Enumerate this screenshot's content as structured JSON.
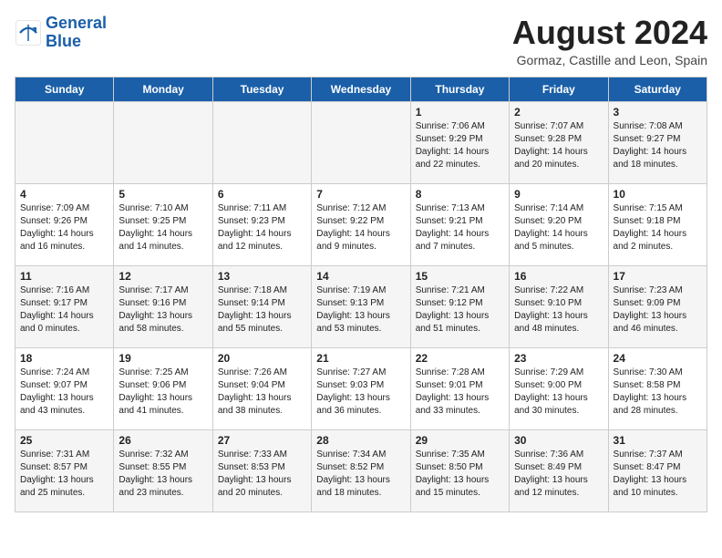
{
  "header": {
    "logo_line1": "General",
    "logo_line2": "Blue",
    "month_year": "August 2024",
    "location": "Gormaz, Castille and Leon, Spain"
  },
  "weekdays": [
    "Sunday",
    "Monday",
    "Tuesday",
    "Wednesday",
    "Thursday",
    "Friday",
    "Saturday"
  ],
  "weeks": [
    [
      {
        "day": "",
        "info": ""
      },
      {
        "day": "",
        "info": ""
      },
      {
        "day": "",
        "info": ""
      },
      {
        "day": "",
        "info": ""
      },
      {
        "day": "1",
        "info": "Sunrise: 7:06 AM\nSunset: 9:29 PM\nDaylight: 14 hours\nand 22 minutes."
      },
      {
        "day": "2",
        "info": "Sunrise: 7:07 AM\nSunset: 9:28 PM\nDaylight: 14 hours\nand 20 minutes."
      },
      {
        "day": "3",
        "info": "Sunrise: 7:08 AM\nSunset: 9:27 PM\nDaylight: 14 hours\nand 18 minutes."
      }
    ],
    [
      {
        "day": "4",
        "info": "Sunrise: 7:09 AM\nSunset: 9:26 PM\nDaylight: 14 hours\nand 16 minutes."
      },
      {
        "day": "5",
        "info": "Sunrise: 7:10 AM\nSunset: 9:25 PM\nDaylight: 14 hours\nand 14 minutes."
      },
      {
        "day": "6",
        "info": "Sunrise: 7:11 AM\nSunset: 9:23 PM\nDaylight: 14 hours\nand 12 minutes."
      },
      {
        "day": "7",
        "info": "Sunrise: 7:12 AM\nSunset: 9:22 PM\nDaylight: 14 hours\nand 9 minutes."
      },
      {
        "day": "8",
        "info": "Sunrise: 7:13 AM\nSunset: 9:21 PM\nDaylight: 14 hours\nand 7 minutes."
      },
      {
        "day": "9",
        "info": "Sunrise: 7:14 AM\nSunset: 9:20 PM\nDaylight: 14 hours\nand 5 minutes."
      },
      {
        "day": "10",
        "info": "Sunrise: 7:15 AM\nSunset: 9:18 PM\nDaylight: 14 hours\nand 2 minutes."
      }
    ],
    [
      {
        "day": "11",
        "info": "Sunrise: 7:16 AM\nSunset: 9:17 PM\nDaylight: 14 hours\nand 0 minutes."
      },
      {
        "day": "12",
        "info": "Sunrise: 7:17 AM\nSunset: 9:16 PM\nDaylight: 13 hours\nand 58 minutes."
      },
      {
        "day": "13",
        "info": "Sunrise: 7:18 AM\nSunset: 9:14 PM\nDaylight: 13 hours\nand 55 minutes."
      },
      {
        "day": "14",
        "info": "Sunrise: 7:19 AM\nSunset: 9:13 PM\nDaylight: 13 hours\nand 53 minutes."
      },
      {
        "day": "15",
        "info": "Sunrise: 7:21 AM\nSunset: 9:12 PM\nDaylight: 13 hours\nand 51 minutes."
      },
      {
        "day": "16",
        "info": "Sunrise: 7:22 AM\nSunset: 9:10 PM\nDaylight: 13 hours\nand 48 minutes."
      },
      {
        "day": "17",
        "info": "Sunrise: 7:23 AM\nSunset: 9:09 PM\nDaylight: 13 hours\nand 46 minutes."
      }
    ],
    [
      {
        "day": "18",
        "info": "Sunrise: 7:24 AM\nSunset: 9:07 PM\nDaylight: 13 hours\nand 43 minutes."
      },
      {
        "day": "19",
        "info": "Sunrise: 7:25 AM\nSunset: 9:06 PM\nDaylight: 13 hours\nand 41 minutes."
      },
      {
        "day": "20",
        "info": "Sunrise: 7:26 AM\nSunset: 9:04 PM\nDaylight: 13 hours\nand 38 minutes."
      },
      {
        "day": "21",
        "info": "Sunrise: 7:27 AM\nSunset: 9:03 PM\nDaylight: 13 hours\nand 36 minutes."
      },
      {
        "day": "22",
        "info": "Sunrise: 7:28 AM\nSunset: 9:01 PM\nDaylight: 13 hours\nand 33 minutes."
      },
      {
        "day": "23",
        "info": "Sunrise: 7:29 AM\nSunset: 9:00 PM\nDaylight: 13 hours\nand 30 minutes."
      },
      {
        "day": "24",
        "info": "Sunrise: 7:30 AM\nSunset: 8:58 PM\nDaylight: 13 hours\nand 28 minutes."
      }
    ],
    [
      {
        "day": "25",
        "info": "Sunrise: 7:31 AM\nSunset: 8:57 PM\nDaylight: 13 hours\nand 25 minutes."
      },
      {
        "day": "26",
        "info": "Sunrise: 7:32 AM\nSunset: 8:55 PM\nDaylight: 13 hours\nand 23 minutes."
      },
      {
        "day": "27",
        "info": "Sunrise: 7:33 AM\nSunset: 8:53 PM\nDaylight: 13 hours\nand 20 minutes."
      },
      {
        "day": "28",
        "info": "Sunrise: 7:34 AM\nSunset: 8:52 PM\nDaylight: 13 hours\nand 18 minutes."
      },
      {
        "day": "29",
        "info": "Sunrise: 7:35 AM\nSunset: 8:50 PM\nDaylight: 13 hours\nand 15 minutes."
      },
      {
        "day": "30",
        "info": "Sunrise: 7:36 AM\nSunset: 8:49 PM\nDaylight: 13 hours\nand 12 minutes."
      },
      {
        "day": "31",
        "info": "Sunrise: 7:37 AM\nSunset: 8:47 PM\nDaylight: 13 hours\nand 10 minutes."
      }
    ]
  ]
}
